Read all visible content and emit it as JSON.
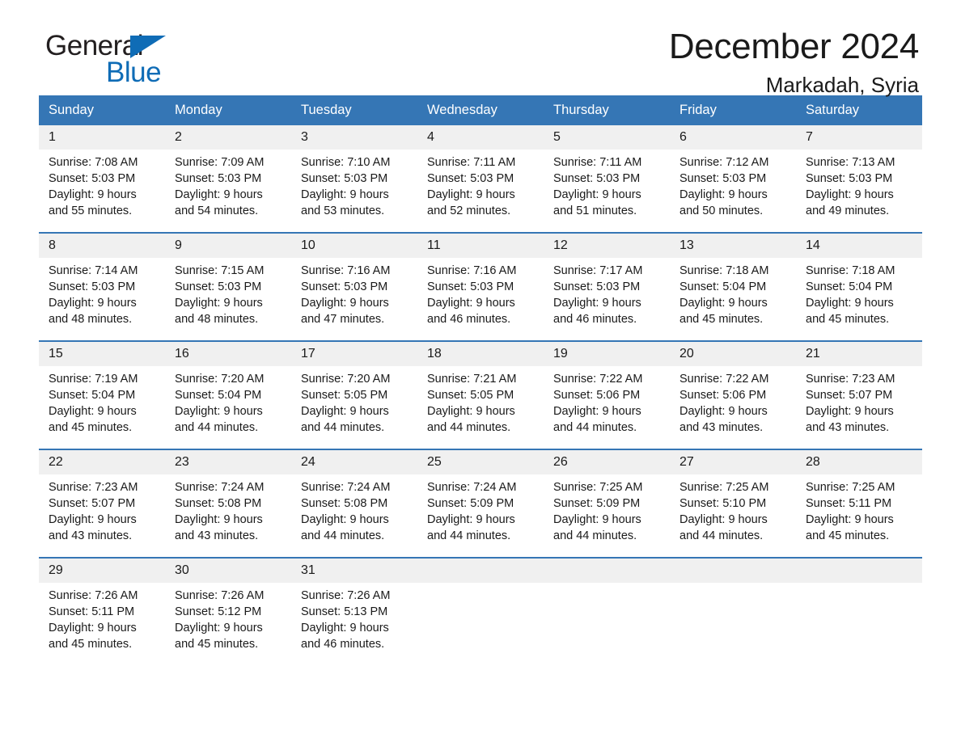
{
  "brand": {
    "name_part1": "General",
    "name_part2": "Blue",
    "triangle_color": "#0f6cb6"
  },
  "header": {
    "title": "December 2024",
    "location": "Markadah, Syria"
  },
  "theme": {
    "header_blue": "#3576b5",
    "daynum_background": "#f0f0f0",
    "text": "#1a1a1a"
  },
  "calendar": {
    "weekday_headers": [
      "Sunday",
      "Monday",
      "Tuesday",
      "Wednesday",
      "Thursday",
      "Friday",
      "Saturday"
    ],
    "weeks": [
      [
        {
          "day": "1",
          "sunrise": "Sunrise: 7:08 AM",
          "sunset": "Sunset: 5:03 PM",
          "daylight_line1": "Daylight: 9 hours",
          "daylight_line2": "and 55 minutes."
        },
        {
          "day": "2",
          "sunrise": "Sunrise: 7:09 AM",
          "sunset": "Sunset: 5:03 PM",
          "daylight_line1": "Daylight: 9 hours",
          "daylight_line2": "and 54 minutes."
        },
        {
          "day": "3",
          "sunrise": "Sunrise: 7:10 AM",
          "sunset": "Sunset: 5:03 PM",
          "daylight_line1": "Daylight: 9 hours",
          "daylight_line2": "and 53 minutes."
        },
        {
          "day": "4",
          "sunrise": "Sunrise: 7:11 AM",
          "sunset": "Sunset: 5:03 PM",
          "daylight_line1": "Daylight: 9 hours",
          "daylight_line2": "and 52 minutes."
        },
        {
          "day": "5",
          "sunrise": "Sunrise: 7:11 AM",
          "sunset": "Sunset: 5:03 PM",
          "daylight_line1": "Daylight: 9 hours",
          "daylight_line2": "and 51 minutes."
        },
        {
          "day": "6",
          "sunrise": "Sunrise: 7:12 AM",
          "sunset": "Sunset: 5:03 PM",
          "daylight_line1": "Daylight: 9 hours",
          "daylight_line2": "and 50 minutes."
        },
        {
          "day": "7",
          "sunrise": "Sunrise: 7:13 AM",
          "sunset": "Sunset: 5:03 PM",
          "daylight_line1": "Daylight: 9 hours",
          "daylight_line2": "and 49 minutes."
        }
      ],
      [
        {
          "day": "8",
          "sunrise": "Sunrise: 7:14 AM",
          "sunset": "Sunset: 5:03 PM",
          "daylight_line1": "Daylight: 9 hours",
          "daylight_line2": "and 48 minutes."
        },
        {
          "day": "9",
          "sunrise": "Sunrise: 7:15 AM",
          "sunset": "Sunset: 5:03 PM",
          "daylight_line1": "Daylight: 9 hours",
          "daylight_line2": "and 48 minutes."
        },
        {
          "day": "10",
          "sunrise": "Sunrise: 7:16 AM",
          "sunset": "Sunset: 5:03 PM",
          "daylight_line1": "Daylight: 9 hours",
          "daylight_line2": "and 47 minutes."
        },
        {
          "day": "11",
          "sunrise": "Sunrise: 7:16 AM",
          "sunset": "Sunset: 5:03 PM",
          "daylight_line1": "Daylight: 9 hours",
          "daylight_line2": "and 46 minutes."
        },
        {
          "day": "12",
          "sunrise": "Sunrise: 7:17 AM",
          "sunset": "Sunset: 5:03 PM",
          "daylight_line1": "Daylight: 9 hours",
          "daylight_line2": "and 46 minutes."
        },
        {
          "day": "13",
          "sunrise": "Sunrise: 7:18 AM",
          "sunset": "Sunset: 5:04 PM",
          "daylight_line1": "Daylight: 9 hours",
          "daylight_line2": "and 45 minutes."
        },
        {
          "day": "14",
          "sunrise": "Sunrise: 7:18 AM",
          "sunset": "Sunset: 5:04 PM",
          "daylight_line1": "Daylight: 9 hours",
          "daylight_line2": "and 45 minutes."
        }
      ],
      [
        {
          "day": "15",
          "sunrise": "Sunrise: 7:19 AM",
          "sunset": "Sunset: 5:04 PM",
          "daylight_line1": "Daylight: 9 hours",
          "daylight_line2": "and 45 minutes."
        },
        {
          "day": "16",
          "sunrise": "Sunrise: 7:20 AM",
          "sunset": "Sunset: 5:04 PM",
          "daylight_line1": "Daylight: 9 hours",
          "daylight_line2": "and 44 minutes."
        },
        {
          "day": "17",
          "sunrise": "Sunrise: 7:20 AM",
          "sunset": "Sunset: 5:05 PM",
          "daylight_line1": "Daylight: 9 hours",
          "daylight_line2": "and 44 minutes."
        },
        {
          "day": "18",
          "sunrise": "Sunrise: 7:21 AM",
          "sunset": "Sunset: 5:05 PM",
          "daylight_line1": "Daylight: 9 hours",
          "daylight_line2": "and 44 minutes."
        },
        {
          "day": "19",
          "sunrise": "Sunrise: 7:22 AM",
          "sunset": "Sunset: 5:06 PM",
          "daylight_line1": "Daylight: 9 hours",
          "daylight_line2": "and 44 minutes."
        },
        {
          "day": "20",
          "sunrise": "Sunrise: 7:22 AM",
          "sunset": "Sunset: 5:06 PM",
          "daylight_line1": "Daylight: 9 hours",
          "daylight_line2": "and 43 minutes."
        },
        {
          "day": "21",
          "sunrise": "Sunrise: 7:23 AM",
          "sunset": "Sunset: 5:07 PM",
          "daylight_line1": "Daylight: 9 hours",
          "daylight_line2": "and 43 minutes."
        }
      ],
      [
        {
          "day": "22",
          "sunrise": "Sunrise: 7:23 AM",
          "sunset": "Sunset: 5:07 PM",
          "daylight_line1": "Daylight: 9 hours",
          "daylight_line2": "and 43 minutes."
        },
        {
          "day": "23",
          "sunrise": "Sunrise: 7:24 AM",
          "sunset": "Sunset: 5:08 PM",
          "daylight_line1": "Daylight: 9 hours",
          "daylight_line2": "and 43 minutes."
        },
        {
          "day": "24",
          "sunrise": "Sunrise: 7:24 AM",
          "sunset": "Sunset: 5:08 PM",
          "daylight_line1": "Daylight: 9 hours",
          "daylight_line2": "and 44 minutes."
        },
        {
          "day": "25",
          "sunrise": "Sunrise: 7:24 AM",
          "sunset": "Sunset: 5:09 PM",
          "daylight_line1": "Daylight: 9 hours",
          "daylight_line2": "and 44 minutes."
        },
        {
          "day": "26",
          "sunrise": "Sunrise: 7:25 AM",
          "sunset": "Sunset: 5:09 PM",
          "daylight_line1": "Daylight: 9 hours",
          "daylight_line2": "and 44 minutes."
        },
        {
          "day": "27",
          "sunrise": "Sunrise: 7:25 AM",
          "sunset": "Sunset: 5:10 PM",
          "daylight_line1": "Daylight: 9 hours",
          "daylight_line2": "and 44 minutes."
        },
        {
          "day": "28",
          "sunrise": "Sunrise: 7:25 AM",
          "sunset": "Sunset: 5:11 PM",
          "daylight_line1": "Daylight: 9 hours",
          "daylight_line2": "and 45 minutes."
        }
      ],
      [
        {
          "day": "29",
          "sunrise": "Sunrise: 7:26 AM",
          "sunset": "Sunset: 5:11 PM",
          "daylight_line1": "Daylight: 9 hours",
          "daylight_line2": "and 45 minutes."
        },
        {
          "day": "30",
          "sunrise": "Sunrise: 7:26 AM",
          "sunset": "Sunset: 5:12 PM",
          "daylight_line1": "Daylight: 9 hours",
          "daylight_line2": "and 45 minutes."
        },
        {
          "day": "31",
          "sunrise": "Sunrise: 7:26 AM",
          "sunset": "Sunset: 5:13 PM",
          "daylight_line1": "Daylight: 9 hours",
          "daylight_line2": "and 46 minutes."
        },
        {
          "day": "",
          "sunrise": "",
          "sunset": "",
          "daylight_line1": "",
          "daylight_line2": ""
        },
        {
          "day": "",
          "sunrise": "",
          "sunset": "",
          "daylight_line1": "",
          "daylight_line2": ""
        },
        {
          "day": "",
          "sunrise": "",
          "sunset": "",
          "daylight_line1": "",
          "daylight_line2": ""
        },
        {
          "day": "",
          "sunrise": "",
          "sunset": "",
          "daylight_line1": "",
          "daylight_line2": ""
        }
      ]
    ]
  }
}
